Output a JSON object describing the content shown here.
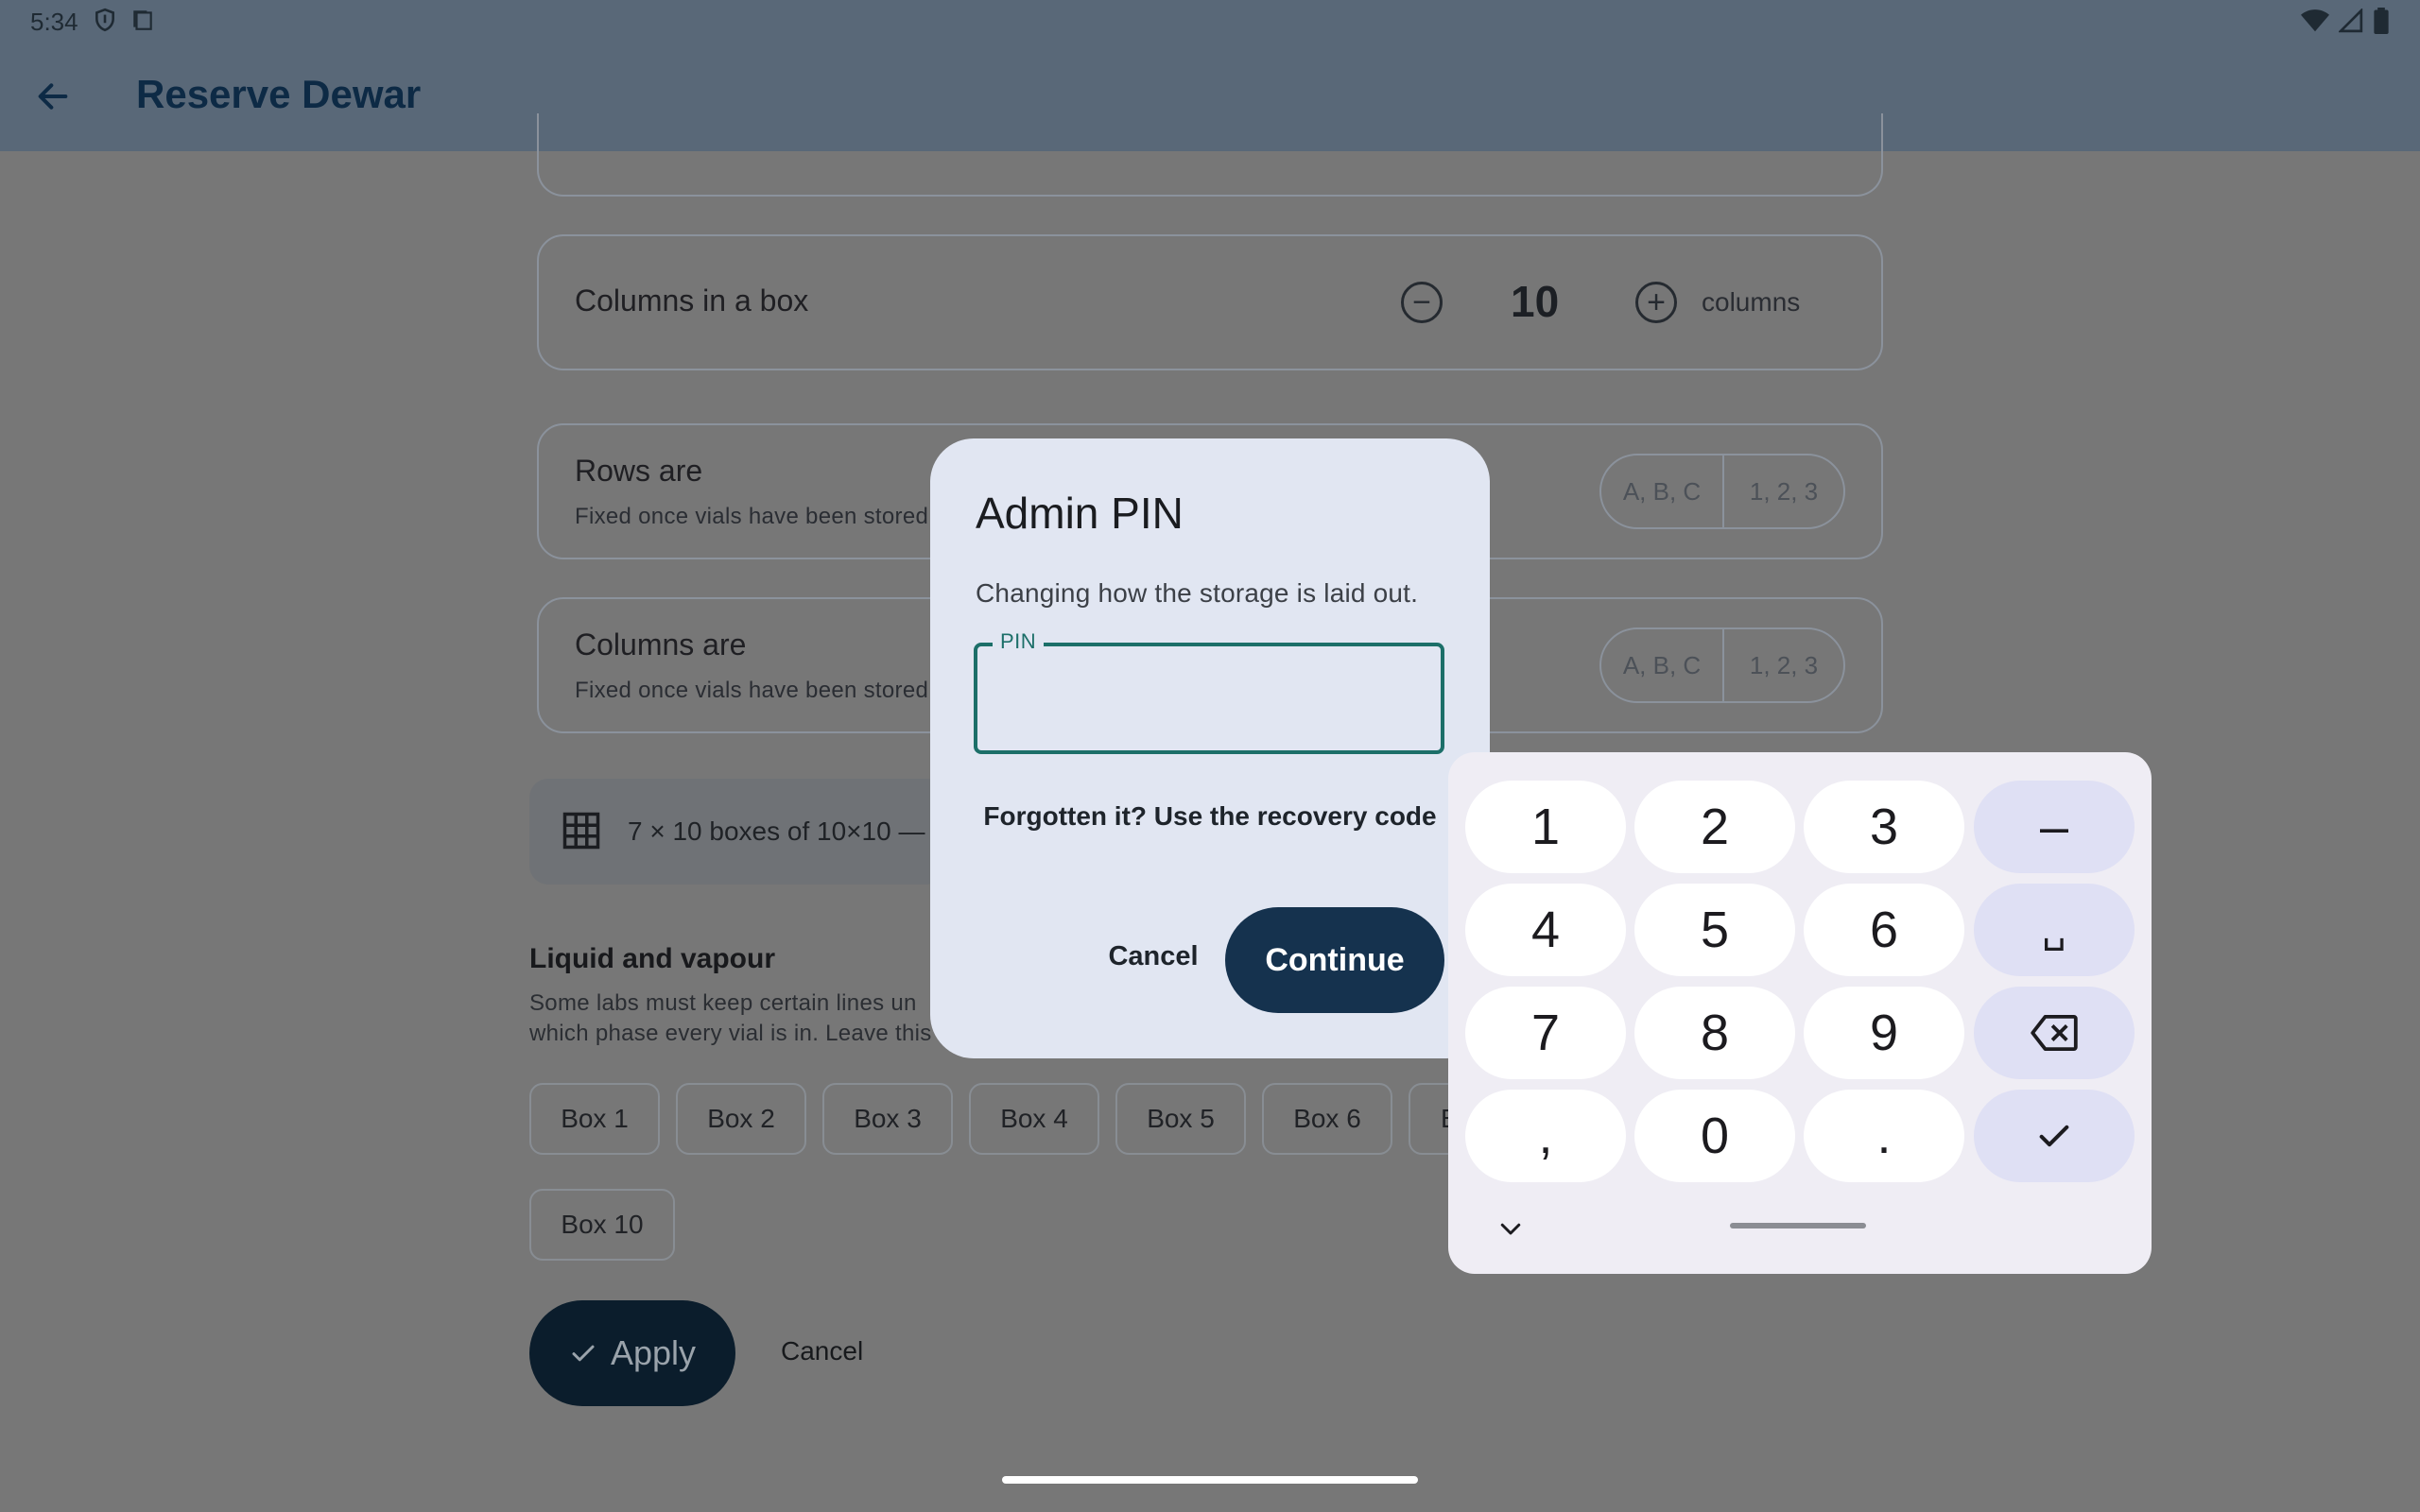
{
  "status_bar": {
    "time": "5:34",
    "icons_left": [
      "shield-icon",
      "clipboard-icon"
    ],
    "icons_right": [
      "wifi-icon",
      "cell-signal-icon",
      "battery-icon"
    ]
  },
  "app_bar": {
    "title": "Reserve Dewar",
    "back_icon": "arrow-left-icon"
  },
  "form": {
    "columns_in_box": {
      "label": "Columns in a box",
      "value": "10",
      "unit": "columns"
    },
    "rows_are": {
      "label": "Rows are",
      "helper": "Fixed once vials have been stored",
      "options": [
        "A, B, C",
        "1, 2, 3"
      ]
    },
    "columns_are": {
      "label": "Columns are",
      "helper": "Fixed once vials have been stored",
      "options": [
        "A, B, C",
        "1, 2, 3"
      ]
    },
    "summary": {
      "icon": "grid-icon",
      "text": "7 × 10 boxes of 10×10 —"
    },
    "liquid_vapour": {
      "heading": "Liquid and vapour",
      "desc_line1": "Some labs must keep certain lines un",
      "desc_line2": "which phase every vial is in. Leave this",
      "boxes": [
        "Box 1",
        "Box 2",
        "Box 3",
        "Box 4",
        "Box 5",
        "Box 6",
        "B",
        "Box 10"
      ]
    },
    "apply_label": "Apply",
    "cancel_label": "Cancel"
  },
  "dialog": {
    "title": "Admin PIN",
    "subtitle": "Changing how the storage is laid out.",
    "pin_label": "PIN",
    "pin_value": "",
    "recovery_link": "Forgotten it? Use the recovery code",
    "cancel_label": "Cancel",
    "continue_label": "Continue"
  },
  "keypad": {
    "keys": [
      [
        "1",
        "2",
        "3",
        "–"
      ],
      [
        "4",
        "5",
        "6",
        "␣"
      ],
      [
        "7",
        "8",
        "9",
        "backspace-icon"
      ],
      [
        ",",
        "0",
        ".",
        "check-icon"
      ]
    ],
    "hide_icon": "chevron-down-icon",
    "function_key_color": "#dfe0f4"
  },
  "colors": {
    "scrim": "#777777",
    "dialog_bg": "#e1e6f2",
    "accent_teal": "#1c6f69",
    "primary_button": "#15324e"
  }
}
